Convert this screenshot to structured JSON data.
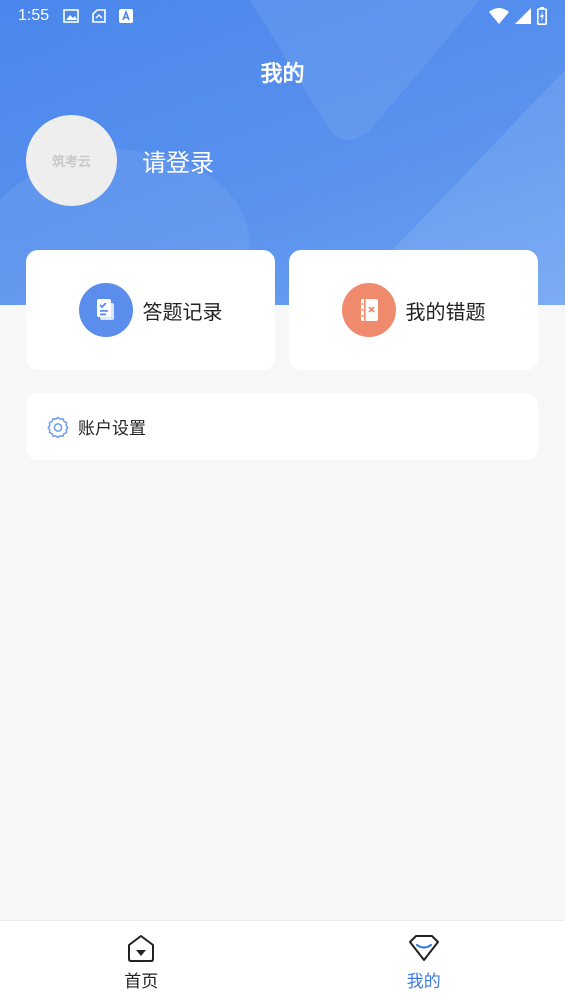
{
  "status_bar": {
    "time": "1:55"
  },
  "header": {
    "title": "我的"
  },
  "profile": {
    "avatar_text": "筑考云",
    "login_label": "请登录"
  },
  "cards": [
    {
      "label": "答题记录",
      "icon": "clipboard-check-icon",
      "color": "#5b8ded"
    },
    {
      "label": "我的错题",
      "icon": "wrong-notebook-icon",
      "color": "#f08a6c"
    }
  ],
  "settings": {
    "label": "账户设置",
    "icon": "gear-icon"
  },
  "tabbar": {
    "items": [
      {
        "label": "首页",
        "icon": "home-icon",
        "active": false
      },
      {
        "label": "我的",
        "icon": "diamond-icon",
        "active": true
      }
    ],
    "active_color": "#3d7be4"
  }
}
